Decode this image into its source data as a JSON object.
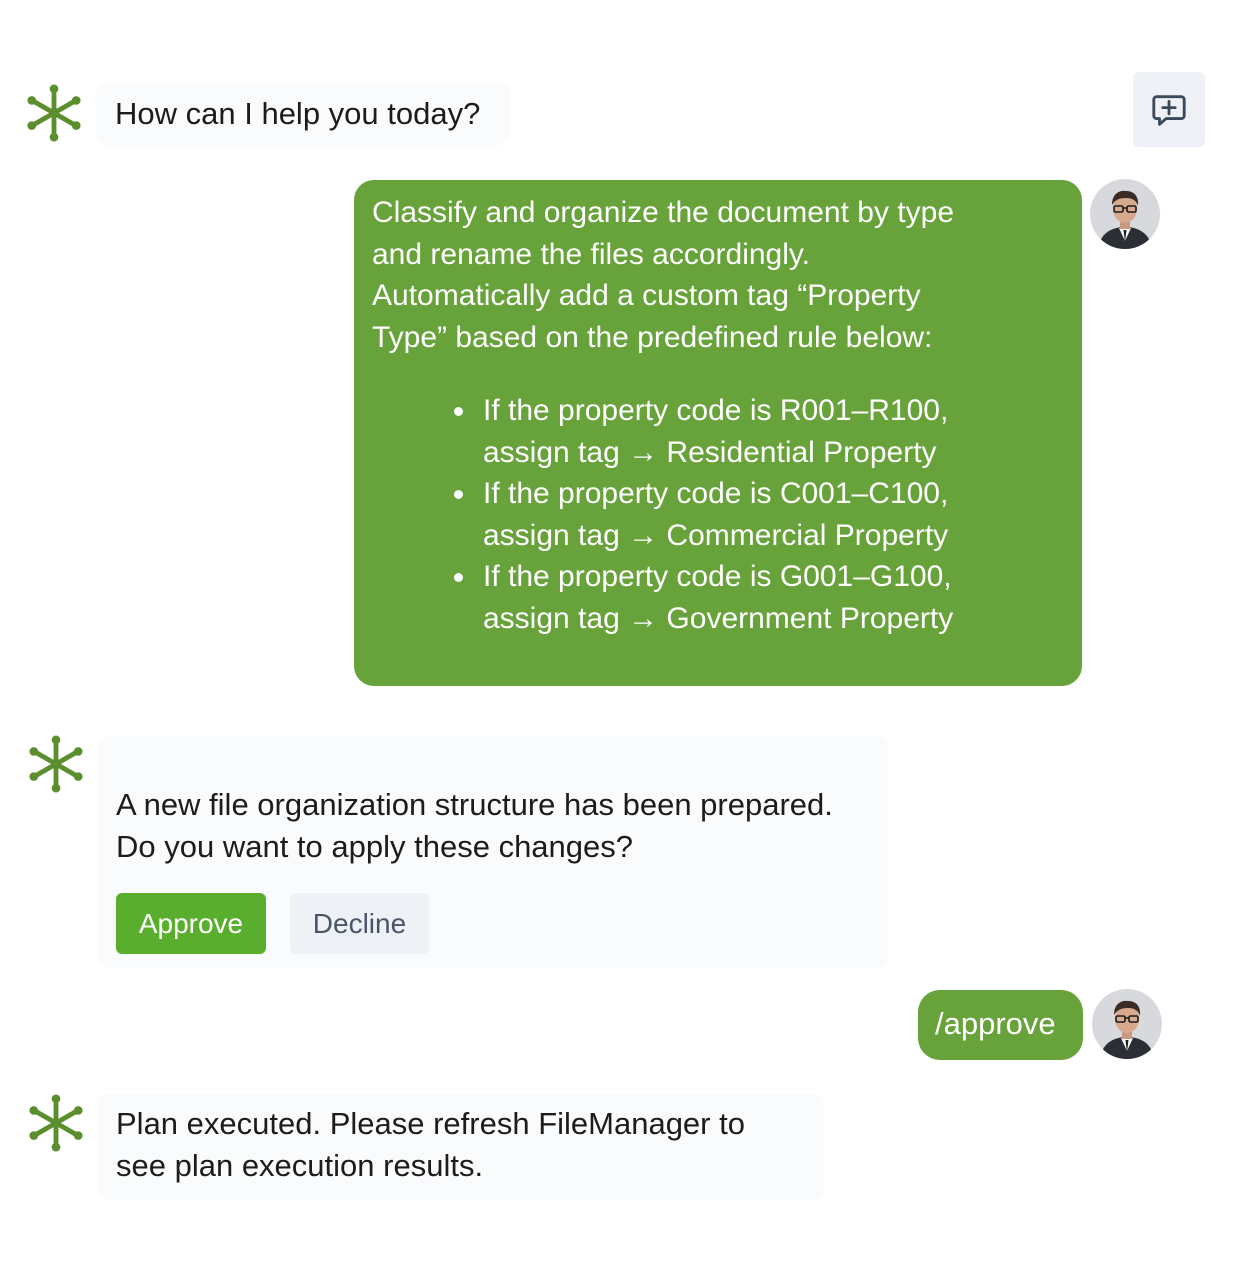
{
  "icons": {
    "bot": "assistant-asterisk-icon",
    "new_chat": "chat-plus-icon",
    "user": "user-avatar-photo"
  },
  "colors": {
    "brand_green": "#5aae2e",
    "user_bubble": "#68a23a",
    "bot_icon": "#5b8f2d"
  },
  "messages": {
    "greeting": "How can I help you today?",
    "user_request": {
      "paragraph_lines": [
        "Classify and organize the document by type",
        "and rename the files accordingly.",
        "Automatically add a custom tag “Property",
        "Type” based on the predefined rule below:"
      ],
      "rules": [
        {
          "line1": "If the property code is R001–R100,",
          "line2": "assign tag → Residential Property"
        },
        {
          "line1": "If the property code is C001–C100,",
          "line2": "assign tag → Commercial Property"
        },
        {
          "line1": "If the property code is G001–G100,",
          "line2": "assign tag → Government Property"
        }
      ]
    },
    "confirm": {
      "line1": "A new file organization structure has been prepared.",
      "line2": "Do you want to apply these changes?",
      "approve_label": "Approve",
      "decline_label": "Decline"
    },
    "user_command": "/approve",
    "result": {
      "line1": "Plan executed. Please refresh FileManager to",
      "line2": "see plan execution results."
    }
  }
}
